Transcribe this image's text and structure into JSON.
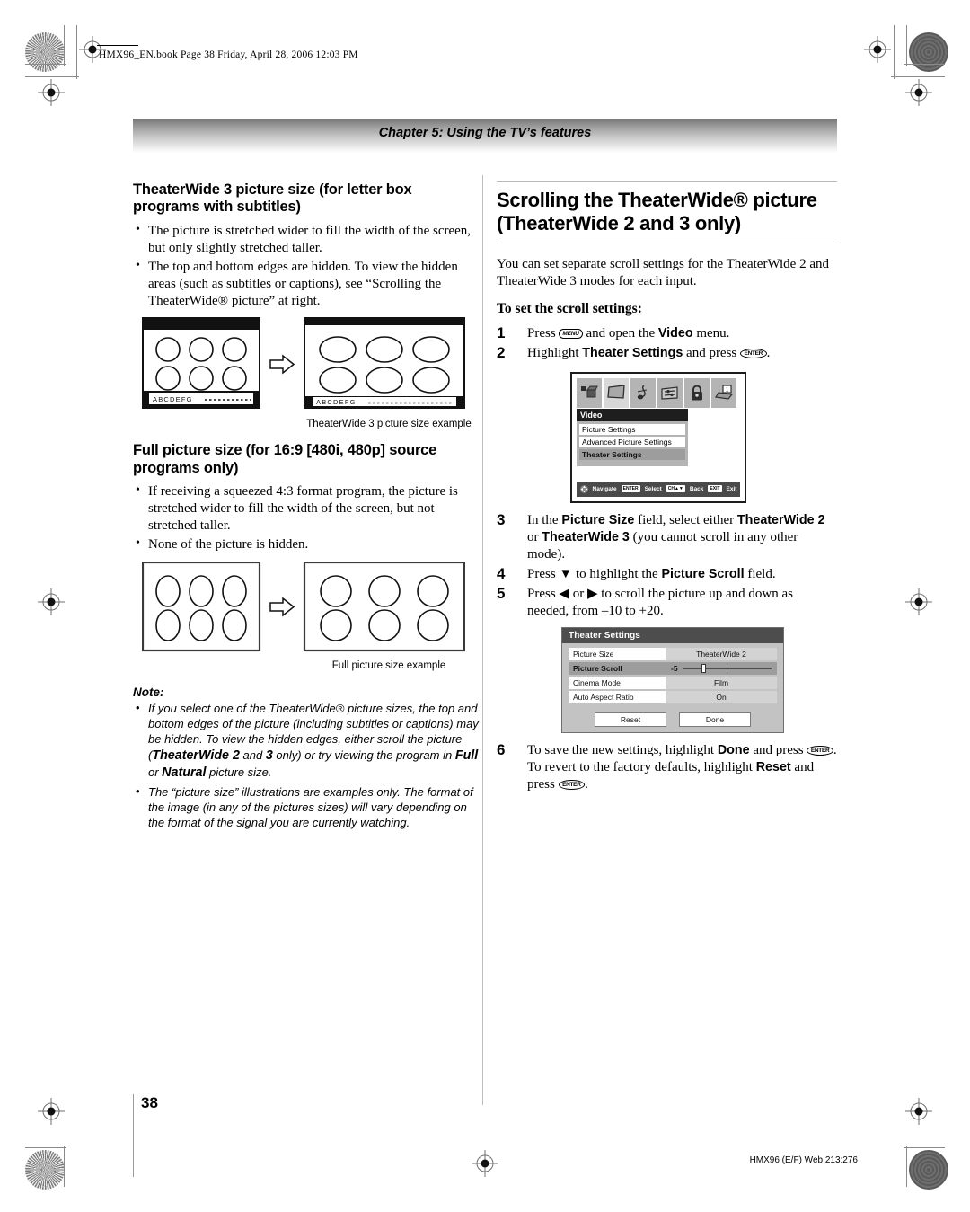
{
  "running_header": "HMX96_EN.book  Page 38  Friday, April 28, 2006  12:03 PM",
  "chapter_bar": {
    "title": "Chapter 5: Using the TV’s features"
  },
  "left_column": {
    "section1": {
      "heading": "TheaterWide 3 picture size (for letter box programs with subtitles)",
      "bullets": [
        "The picture is stretched wider to fill the width of the screen, but only slightly stretched taller.",
        "The top and bottom edges are hidden. To view the hidden areas (such as subtitles or captions), see “Scrolling the TheaterWide® picture” at right."
      ],
      "figure_caption": "TheaterWide 3 picture size example",
      "subtitle_text": "A B C D E F G"
    },
    "section2": {
      "heading": "Full picture size (for 16:9 [480i, 480p] source programs only)",
      "bullets": [
        "If receiving a squeezed 4:3 format program, the picture is stretched wider to fill the width of the screen, but not stretched taller.",
        "None of the picture is hidden."
      ],
      "figure_caption": "Full picture size example"
    },
    "note": {
      "title": "Note:",
      "items": [
        {
          "parts": [
            {
              "t": "If you select one of the TheaterWide",
              "b": false
            },
            {
              "t": "®",
              "b": false
            },
            {
              "t": " picture sizes, the top and bottom edges of the picture (including subtitles or captions) may be hidden. To view the hidden edges, either scroll the picture (",
              "b": false
            },
            {
              "t": "TheaterWide 2",
              "b": true
            },
            {
              "t": " and ",
              "b": false
            },
            {
              "t": "3",
              "b": true
            },
            {
              "t": " only) or try viewing the program in ",
              "b": false
            },
            {
              "t": "Full",
              "b": true
            },
            {
              "t": " or ",
              "b": false
            },
            {
              "t": "Natural",
              "b": true
            },
            {
              "t": " picture size.",
              "b": false
            }
          ]
        },
        {
          "parts": [
            {
              "t": "The “picture size” illustrations are examples only. The format of the image (in any of the pictures sizes) will vary depending on the format of the signal you are currently watching.",
              "b": false
            }
          ]
        }
      ]
    }
  },
  "right_column": {
    "heading_line1": "Scrolling the TheaterWide® picture",
    "heading_line2": "(TheaterWide 2 and 3 only)",
    "intro": "You can set separate scroll settings for the TheaterWide 2 and TheaterWide 3 modes for each input.",
    "steps_title": "To set the scroll settings:",
    "steps": [
      {
        "num": "1",
        "parts": [
          {
            "t": "Press ",
            "k": null,
            "b": false
          },
          {
            "t": "",
            "k": "MENU",
            "b": false
          },
          {
            "t": " and open the ",
            "k": null,
            "b": false
          },
          {
            "t": "Video",
            "k": null,
            "b": true
          },
          {
            "t": " menu.",
            "k": null,
            "b": false
          }
        ]
      },
      {
        "num": "2",
        "parts": [
          {
            "t": "Highlight ",
            "k": null,
            "b": false
          },
          {
            "t": "Theater Settings",
            "k": null,
            "b": true
          },
          {
            "t": " and press ",
            "k": null,
            "b": false
          },
          {
            "t": "",
            "k": "ENTER",
            "b": false
          },
          {
            "t": ".",
            "k": null,
            "b": false
          }
        ]
      },
      {
        "num": "3",
        "parts": [
          {
            "t": "In the ",
            "k": null,
            "b": false
          },
          {
            "t": "Picture Size",
            "k": null,
            "b": true
          },
          {
            "t": " field, select either ",
            "k": null,
            "b": false
          },
          {
            "t": "TheaterWide 2",
            "k": null,
            "b": true
          },
          {
            "t": " or ",
            "k": null,
            "b": false
          },
          {
            "t": "TheaterWide 3",
            "k": null,
            "b": true
          },
          {
            "t": " (you cannot scroll in any other mode).",
            "k": null,
            "b": false
          }
        ]
      },
      {
        "num": "4",
        "parts": [
          {
            "t": "Press ▼ to highlight the ",
            "k": null,
            "b": false
          },
          {
            "t": "Picture Scroll",
            "k": null,
            "b": true
          },
          {
            "t": " field.",
            "k": null,
            "b": false
          }
        ]
      },
      {
        "num": "5",
        "parts": [
          {
            "t": "Press ◀ or ▶ to scroll the picture up and down as needed, from –10 to +20.",
            "k": null,
            "b": false
          }
        ]
      },
      {
        "num": "6",
        "parts": [
          {
            "t": "To save the new settings, highlight ",
            "k": null,
            "b": false
          },
          {
            "t": "Done",
            "k": null,
            "b": true
          },
          {
            "t": " and press ",
            "k": null,
            "b": false
          },
          {
            "t": "",
            "k": "ENTER",
            "b": false
          },
          {
            "t": ". To revert to the factory defaults, highlight ",
            "k": null,
            "b": false
          },
          {
            "t": "Reset",
            "k": null,
            "b": true
          },
          {
            "t": " and press ",
            "k": null,
            "b": false
          },
          {
            "t": "",
            "k": "ENTER",
            "b": false
          },
          {
            "t": ".",
            "k": null,
            "b": false
          }
        ]
      }
    ],
    "osd_video": {
      "title": "Video",
      "icons": [
        "input-antenna-icon",
        "video-screen-icon",
        "audio-note-icon",
        "settings-sliders-icon",
        "lock-icon",
        "setup-icon"
      ],
      "selected_icon_index": 1,
      "items": [
        {
          "label": "Picture Settings",
          "highlighted": false
        },
        {
          "label": "Advanced Picture Settings",
          "highlighted": false
        },
        {
          "label": "Theater Settings",
          "highlighted": true
        }
      ],
      "bottom_bar": [
        {
          "key": "",
          "label": "Navigate",
          "icon": "dpad-icon"
        },
        {
          "key": "ENTER",
          "label": "Select",
          "icon": null
        },
        {
          "key": "CH▲▼",
          "label": "Back",
          "icon": null
        },
        {
          "key": "EXIT",
          "label": "Exit",
          "icon": null
        }
      ]
    },
    "osd_theater": {
      "title": "Theater Settings",
      "rows": [
        {
          "label": "Picture Size",
          "value": "TheaterWide 2",
          "type": "value",
          "highlighted": false
        },
        {
          "label": "Picture Scroll",
          "value": "-5",
          "type": "slider",
          "highlighted": true,
          "slider_percent": 22
        },
        {
          "label": "Cinema Mode",
          "value": "Film",
          "type": "value",
          "highlighted": false
        },
        {
          "label": "Auto Aspect Ratio",
          "value": "On",
          "type": "value",
          "highlighted": false
        }
      ],
      "buttons": [
        {
          "label": "Reset"
        },
        {
          "label": "Done"
        }
      ]
    }
  },
  "footer": {
    "page_number": "38",
    "code": "HMX96 (E/F) Web 213:276"
  }
}
